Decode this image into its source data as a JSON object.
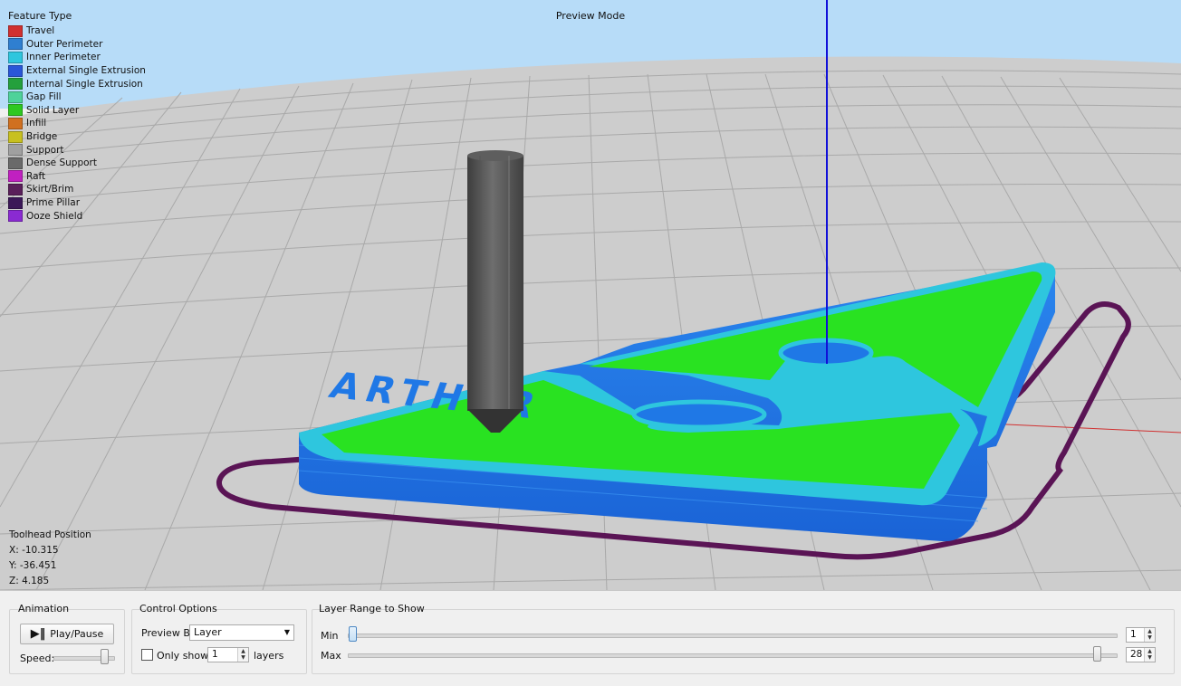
{
  "viewport": {
    "mode_title": "Preview Mode",
    "legend": {
      "title": "Feature Type",
      "items": [
        {
          "label": "Travel",
          "color": "#d03030"
        },
        {
          "label": "Outer Perimeter",
          "color": "#2f7fd0"
        },
        {
          "label": "Inner Perimeter",
          "color": "#2ec6de"
        },
        {
          "label": "External Single Extrusion",
          "color": "#2a56d8"
        },
        {
          "label": "Internal Single Extrusion",
          "color": "#24a03c"
        },
        {
          "label": "Gap Fill",
          "color": "#4ed29a"
        },
        {
          "label": "Solid Layer",
          "color": "#2ec820"
        },
        {
          "label": "Infill",
          "color": "#d07020"
        },
        {
          "label": "Bridge",
          "color": "#c8c020"
        },
        {
          "label": "Support",
          "color": "#a0a0a0"
        },
        {
          "label": "Dense Support",
          "color": "#6a6a6a"
        },
        {
          "label": "Raft",
          "color": "#c020c0"
        },
        {
          "label": "Skirt/Brim",
          "color": "#5a1f5a"
        },
        {
          "label": "Prime Pillar",
          "color": "#3c1858"
        },
        {
          "label": "Ooze Shield",
          "color": "#8a2ad2"
        }
      ]
    },
    "toolhead": {
      "title": "Toolhead Position",
      "x": "X: -10.315",
      "y": "Y: -36.451",
      "z": "Z: 4.185"
    },
    "model_text": "ARTHUR",
    "colors": {
      "sky": "#b7dcf8",
      "floor": "#cfcfcf",
      "perimeter": "#1f78e6",
      "solid": "#29e221",
      "skirt": "#5a1455"
    }
  },
  "controls": {
    "animation": {
      "title": "Animation",
      "play_label": "Play/Pause",
      "speed_label": "Speed:"
    },
    "control_options": {
      "title": "Control Options",
      "preview_by_label": "Preview By",
      "preview_by_value": "Layer",
      "only_show_label": "Only show",
      "only_show_value": "1",
      "layers_label": "layers"
    },
    "layer_range": {
      "title": "Layer Range to Show",
      "min_label": "Min",
      "min_value": "1",
      "max_label": "Max",
      "max_value": "28"
    }
  }
}
